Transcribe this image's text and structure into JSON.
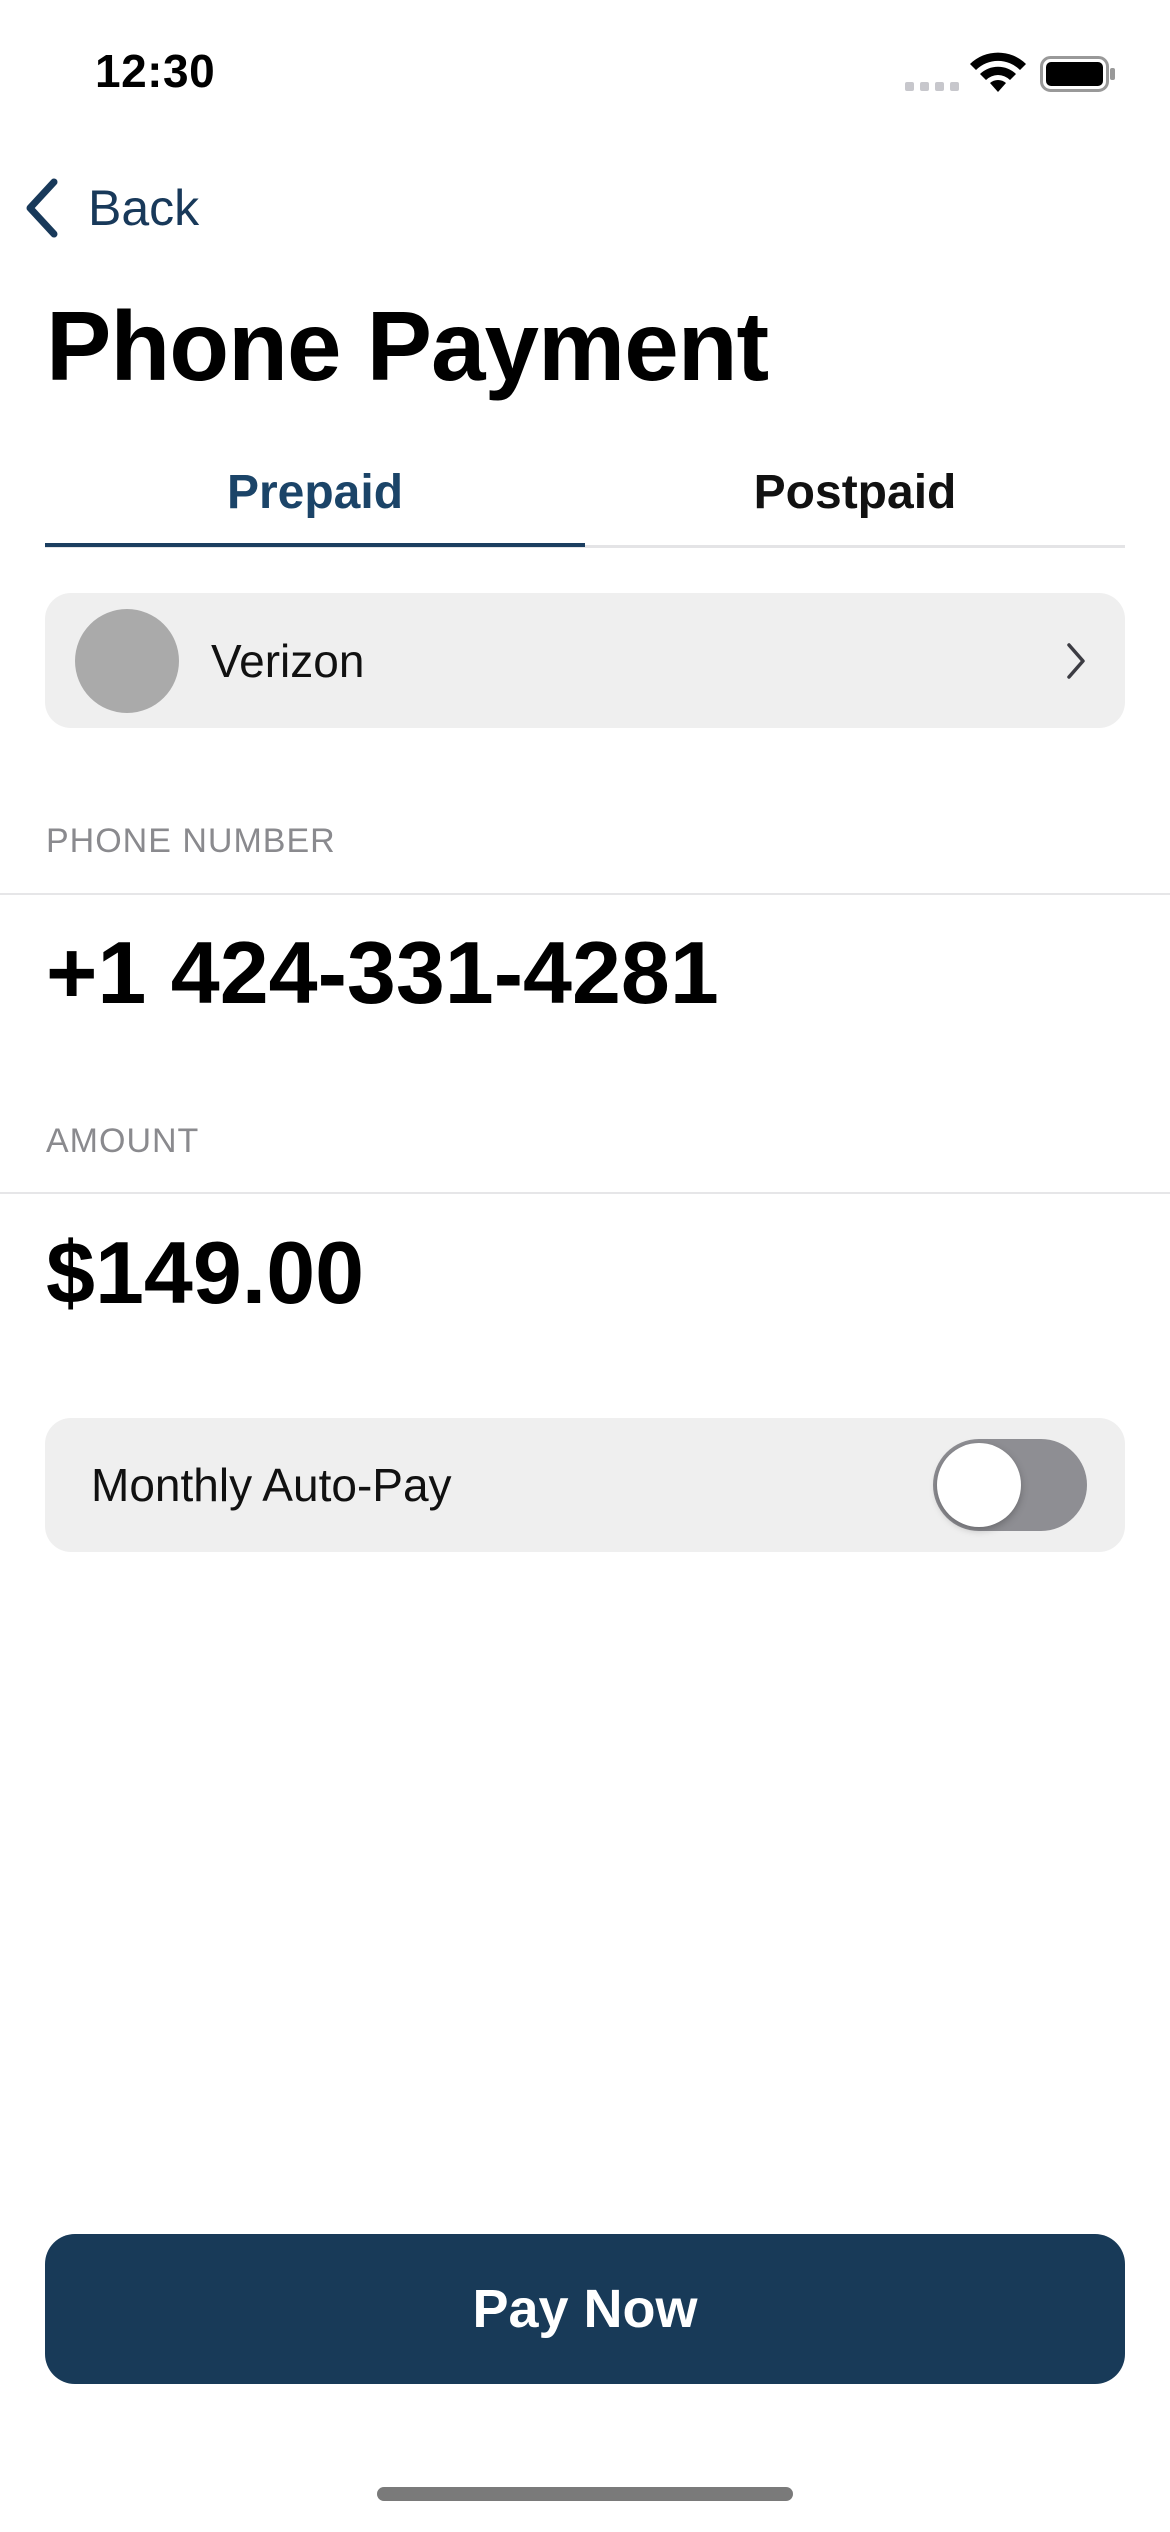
{
  "status_bar": {
    "time": "12:30",
    "icons": [
      "signal-icon",
      "wifi-icon",
      "battery-icon"
    ]
  },
  "nav": {
    "back_label": "Back",
    "back_icon": "chevron-left-icon"
  },
  "page_title": "Phone Payment",
  "tabs": [
    {
      "label": "Prepaid",
      "selected": true
    },
    {
      "label": "Postpaid",
      "selected": false
    }
  ],
  "carrier": {
    "name": "Verizon",
    "icon": "chevron-right-icon"
  },
  "phone": {
    "label": "PHONE NUMBER",
    "value": "+1 424-331-4281"
  },
  "amount": {
    "label": "AMOUNT",
    "value": "$149.00"
  },
  "autopay": {
    "label": "Monthly Auto-Pay",
    "enabled": false
  },
  "pay_button": {
    "label": "Pay Now"
  },
  "colors": {
    "accent": "#1b3e60",
    "button": "#183a58",
    "row_background": "#efefef",
    "toggle_off": "#8e8e93"
  }
}
